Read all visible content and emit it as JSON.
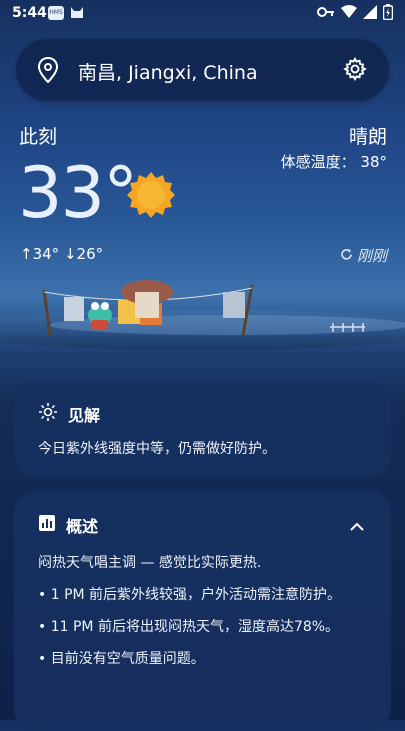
{
  "status_bar": {
    "time": "5:44",
    "noti_label": "HMS"
  },
  "search": {
    "location": "南昌, Jiangxi, China"
  },
  "current": {
    "label": "此刻",
    "temperature": "33°",
    "condition": "晴朗",
    "feels_like": "体感温度： 38°",
    "high": "34°",
    "low": "26°",
    "updated": "刚刚"
  },
  "insight": {
    "title": "见解",
    "text": "今日紫外线强度中等，仍需做好防护。"
  },
  "overview": {
    "title": "概述",
    "summary": "闷热天气唱主调 — 感觉比实际更热.",
    "items": [
      "• 1 PM 前后紫外线较强，户外活动需注意防护。",
      "• 11 PM 前后将出现闷热天气，湿度高达78%。",
      "• 目前没有空气质量问题。"
    ]
  },
  "colors": {
    "accent_sun": "#f5a623",
    "card": "#16305f"
  }
}
